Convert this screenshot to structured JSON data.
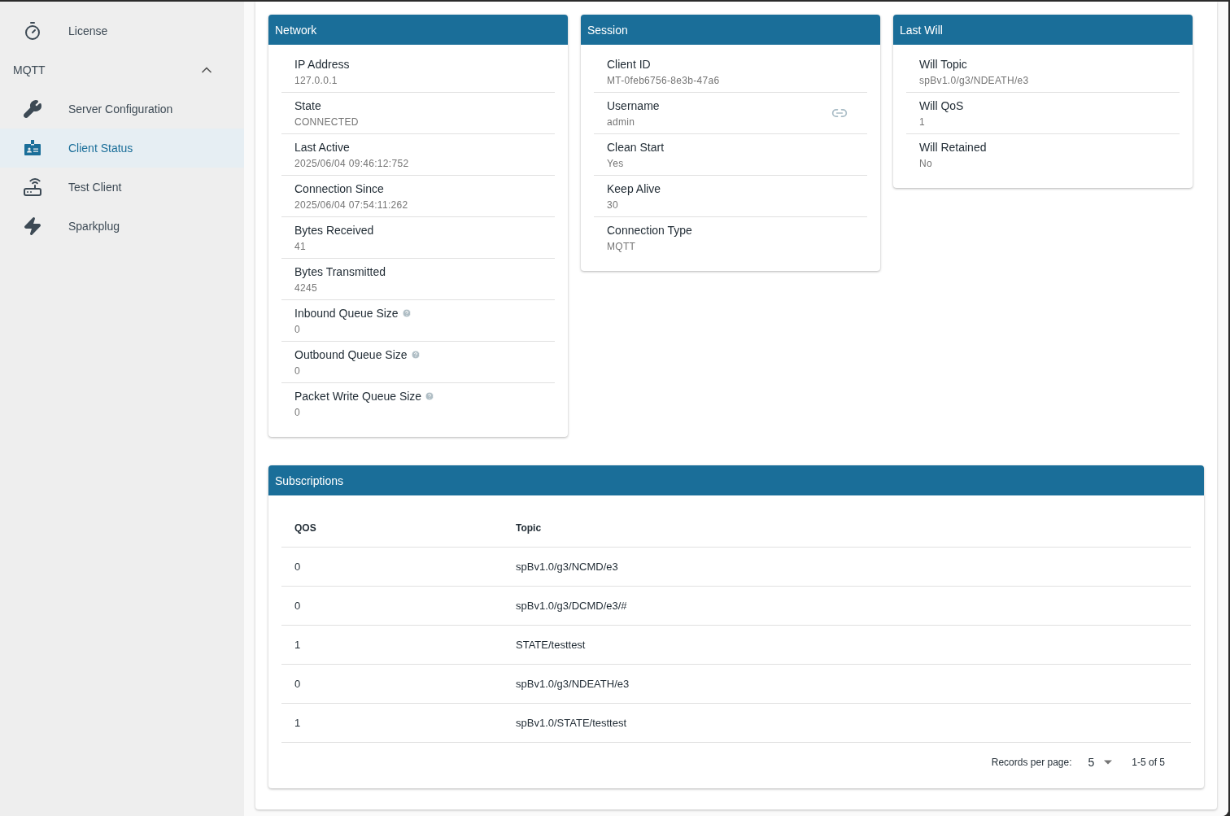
{
  "sidebar": {
    "items": [
      {
        "label": "License",
        "selected": false
      }
    ],
    "groups": [
      {
        "title": "MQTT",
        "expanded": true,
        "items": [
          {
            "label": "Server Configuration",
            "selected": false
          },
          {
            "label": "Client Status",
            "selected": true
          },
          {
            "label": "Test Client",
            "selected": false
          },
          {
            "label": "Sparkplug",
            "selected": false
          }
        ]
      }
    ]
  },
  "cards": [
    {
      "title": "Network",
      "fields": [
        {
          "label": "IP Address",
          "value": "127.0.0.1"
        },
        {
          "label": "State",
          "value": "CONNECTED"
        },
        {
          "label": "Last Active",
          "value": "2025/06/04 09:46:12:752"
        },
        {
          "label": "Connection Since",
          "value": "2025/06/04 07:54:11:262"
        },
        {
          "label": "Bytes Received",
          "value": "41"
        },
        {
          "label": "Bytes Transmitted",
          "value": "4245"
        },
        {
          "label": "Inbound Queue Size",
          "value": "0",
          "help": true
        },
        {
          "label": "Outbound Queue Size",
          "value": "0",
          "help": true
        },
        {
          "label": "Packet Write Queue Size",
          "value": "0",
          "help": true
        }
      ]
    },
    {
      "title": "Session",
      "fields": [
        {
          "label": "Client ID",
          "value": "MT-0feb6756-8e3b-47a6"
        },
        {
          "label": "Username",
          "value": "admin",
          "link": true
        },
        {
          "label": "Clean Start",
          "value": "Yes"
        },
        {
          "label": "Keep Alive",
          "value": "30"
        },
        {
          "label": "Connection Type",
          "value": "MQTT"
        }
      ]
    },
    {
      "title": "Last Will",
      "fields": [
        {
          "label": "Will Topic",
          "value": "spBv1.0/g3/NDEATH/e3"
        },
        {
          "label": "Will QoS",
          "value": "1"
        },
        {
          "label": "Will Retained",
          "value": "No"
        }
      ]
    }
  ],
  "subscriptions": {
    "title": "Subscriptions",
    "columns": [
      "QOS",
      "Topic"
    ],
    "rows": [
      [
        "0",
        "spBv1.0/g3/NCMD/e3"
      ],
      [
        "0",
        "spBv1.0/g3/DCMD/e3/#"
      ],
      [
        "1",
        "STATE/testtest"
      ],
      [
        "0",
        "spBv1.0/g3/NDEATH/e3"
      ],
      [
        "1",
        "spBv1.0/STATE/testtest"
      ]
    ],
    "pagination": {
      "label": "Records per page:",
      "per_page": "5",
      "range": "1-5 of 5"
    }
  }
}
